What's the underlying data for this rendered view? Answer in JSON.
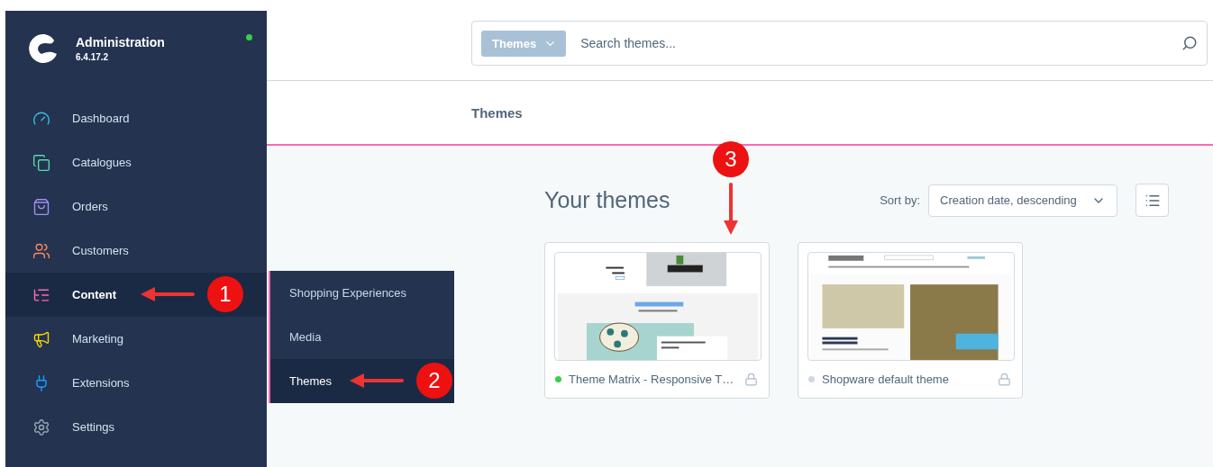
{
  "app": {
    "title": "Administration",
    "version": "6.4.17.2",
    "online": true
  },
  "sidebar": {
    "items": [
      {
        "label": "Dashboard",
        "kind": "dashboard",
        "color": "#3ebfd9",
        "selected": false
      },
      {
        "label": "Catalogues",
        "kind": "catalogues",
        "color": "#57d9a3",
        "selected": false
      },
      {
        "label": "Orders",
        "kind": "orders",
        "color": "#a092f0",
        "selected": false
      },
      {
        "label": "Customers",
        "kind": "customers",
        "color": "#f88962",
        "selected": false
      },
      {
        "label": "Content",
        "kind": "content",
        "color": "#ff68b4",
        "selected": true,
        "annotation": "1"
      },
      {
        "label": "Marketing",
        "kind": "marketing",
        "color": "#ffd700",
        "selected": false
      },
      {
        "label": "Extensions",
        "kind": "extensions",
        "color": "#189eff",
        "selected": false
      },
      {
        "label": "Settings",
        "kind": "settings",
        "color": "#9aa8b5",
        "selected": false
      }
    ]
  },
  "submenu": {
    "items": [
      {
        "label": "Shopping Experiences",
        "selected": false
      },
      {
        "label": "Media",
        "selected": false
      },
      {
        "label": "Themes",
        "selected": true,
        "annotation": "2"
      }
    ]
  },
  "search": {
    "scope": "Themes",
    "placeholder": "Search themes..."
  },
  "page": {
    "title": "Themes"
  },
  "themes": {
    "heading": "Your themes",
    "sort_label": "Sort by:",
    "sort_value": "Creation date, descending",
    "items": [
      {
        "name": "Theme Matrix - Responsive T…",
        "active": true,
        "kind": "matrix",
        "annotation": "3"
      },
      {
        "name": "Shopware default theme",
        "active": false,
        "kind": "default"
      }
    ]
  }
}
